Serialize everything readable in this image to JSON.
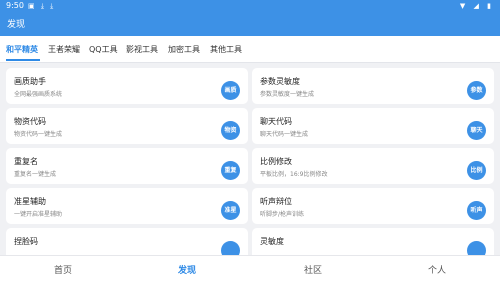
{
  "status": {
    "time": "9:50"
  },
  "appbar": {
    "title": "发现"
  },
  "tabs": [
    "和平精英",
    "王者荣耀",
    "QQ工具",
    "影视工具",
    "加密工具",
    "其他工具"
  ],
  "cards": [
    {
      "title": "画质助手",
      "subtitle": "全网最强画质系统",
      "badge": "画质"
    },
    {
      "title": "参数灵敏度",
      "subtitle": "参数灵敏度一键生成",
      "badge": "参数"
    },
    {
      "title": "物资代码",
      "subtitle": "物资代码一键生成",
      "badge": "物资"
    },
    {
      "title": "聊天代码",
      "subtitle": "聊天代码一键生成",
      "badge": "聊天"
    },
    {
      "title": "重复名",
      "subtitle": "重复名一键生成",
      "badge": "重复"
    },
    {
      "title": "比例修改",
      "subtitle": "平板比例，16:9比例修改",
      "badge": "比例"
    },
    {
      "title": "准星辅助",
      "subtitle": "一键开启准星辅助",
      "badge": "准星"
    },
    {
      "title": "听声辩位",
      "subtitle": "听脚步/枪声训练",
      "badge": "听声"
    },
    {
      "title": "捏脸码",
      "subtitle": "",
      "badge": ""
    },
    {
      "title": "灵敏度",
      "subtitle": "",
      "badge": ""
    }
  ],
  "bottom_nav": [
    "首页",
    "发现",
    "社区",
    "个人"
  ],
  "colors": {
    "primary": "#3d91e6",
    "active_tab": "#2f8ae6"
  }
}
